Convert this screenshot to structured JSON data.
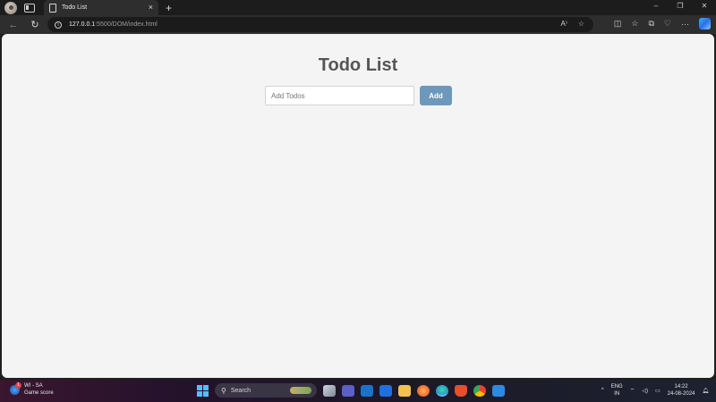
{
  "browser": {
    "tab_title": "Todo List",
    "tab_close": "×",
    "new_tab": "+",
    "url_host": "127.0.0.1",
    "url_rest": ":5500/DOM/index.html",
    "window_controls": {
      "minimize": "–",
      "restore": "❐",
      "close": "✕"
    },
    "nav": {
      "back": "←",
      "reload": "↻"
    },
    "address_icons": {
      "read_aloud": "A⁾",
      "favorite": "☆"
    },
    "toolbar_icons": {
      "split": "◫",
      "favorites": "☆",
      "collections": "⧉",
      "extensions": "♡",
      "more": "···"
    }
  },
  "page": {
    "title": "Todo List",
    "input_placeholder": "Add Todos",
    "input_value": "",
    "add_button": "Add"
  },
  "colors": {
    "add_button_bg": "#6e98bb",
    "title_color": "#555555",
    "page_bg": "#f4f4f4"
  },
  "taskbar": {
    "weather_title": "WI - SA",
    "weather_subtitle": "Game score",
    "weather_badge": "1",
    "search_label": "Search",
    "search_glyph": "⚲",
    "tray_chevron": "^",
    "language_top": "ENG",
    "language_bottom": "IN",
    "wifi": "⌔",
    "volume": "◁)",
    "battery": "▭",
    "bell": "🔔︎",
    "time": "14:22",
    "date": "24-08-2024"
  }
}
